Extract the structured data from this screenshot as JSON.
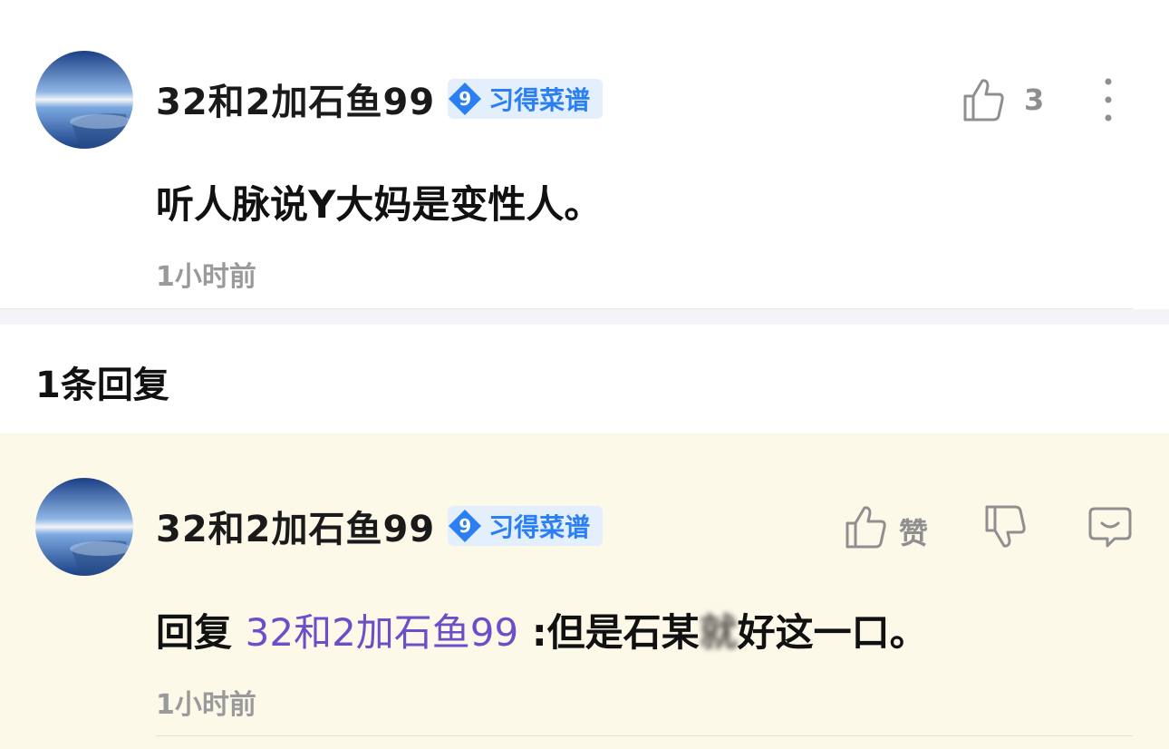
{
  "main_comment": {
    "username": "32和2加石鱼99",
    "badge_level": "9",
    "badge_text": "习得菜谱",
    "content": "听人脉说Y大妈是变性人。",
    "time": "1小时前",
    "like_count": "3"
  },
  "reply_section": {
    "count_label": "1条回复"
  },
  "reply": {
    "username": "32和2加石鱼99",
    "badge_level": "9",
    "badge_text": "习得菜谱",
    "prefix": "回复 ",
    "reply_to": "32和2加石鱼99",
    "text_before_blur": " :但是石某",
    "blurred_text": "就",
    "text_after_blur": "好这一口。",
    "time": "1小时前",
    "like_label": "赞"
  },
  "colors": {
    "badge_bg": "#e3effd",
    "badge_accent": "#2b7ff2",
    "reply_bg": "#fcf9e9",
    "mention": "#6a4fc8",
    "muted": "#9a9a9a"
  },
  "icons": [
    "thumbs-up-icon",
    "thumbs-down-icon",
    "more-vertical-icon",
    "comment-reply-icon"
  ]
}
